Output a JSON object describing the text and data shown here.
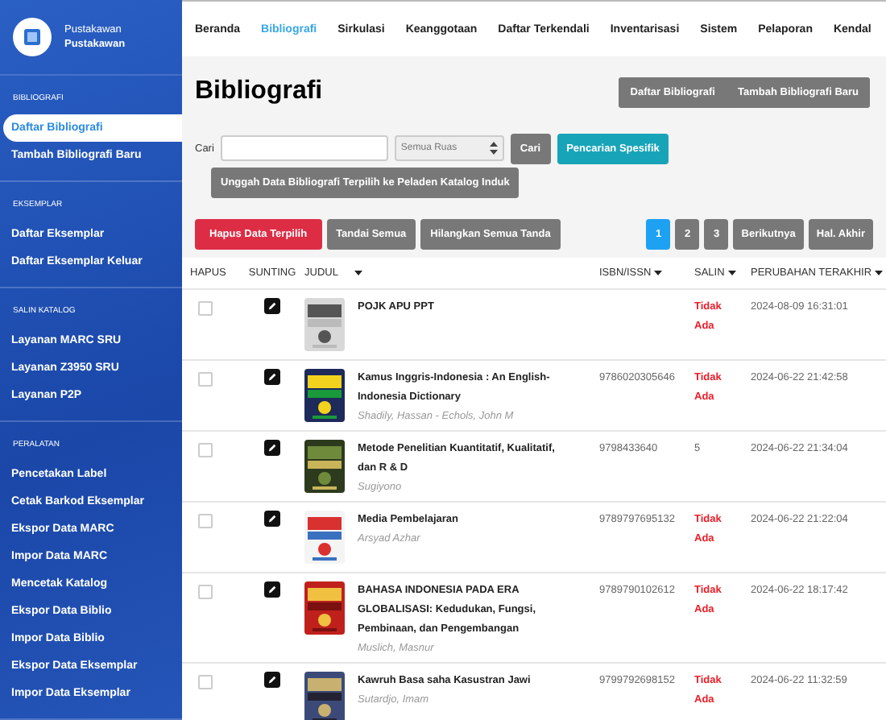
{
  "sidebar": {
    "user_role": "Pustakawan",
    "user_name": "Pustakawan",
    "sections": [
      {
        "label": "BIBLIOGRAFI",
        "items": [
          {
            "label": "Daftar Bibliografi",
            "selected": true
          },
          {
            "label": "Tambah Bibliografi Baru",
            "selected": false
          }
        ]
      },
      {
        "label": "EKSEMPLAR",
        "items": [
          {
            "label": "Daftar Eksemplar",
            "selected": false
          },
          {
            "label": "Daftar Eksemplar Keluar",
            "selected": false
          }
        ]
      },
      {
        "label": "SALIN KATALOG",
        "items": [
          {
            "label": "Layanan MARC SRU",
            "selected": false
          },
          {
            "label": "Layanan Z3950 SRU",
            "selected": false
          },
          {
            "label": "Layanan P2P",
            "selected": false
          }
        ]
      },
      {
        "label": "PERALATAN",
        "items": [
          {
            "label": "Pencetakan Label",
            "selected": false
          },
          {
            "label": "Cetak Barkod Eksemplar",
            "selected": false
          },
          {
            "label": "Ekspor Data MARC",
            "selected": false
          },
          {
            "label": "Impor Data MARC",
            "selected": false
          },
          {
            "label": "Mencetak Katalog",
            "selected": false
          },
          {
            "label": "Ekspor Data Biblio",
            "selected": false
          },
          {
            "label": "Impor Data Biblio",
            "selected": false
          },
          {
            "label": "Ekspor Data Eksemplar",
            "selected": false
          },
          {
            "label": "Impor Data Eksemplar",
            "selected": false
          }
        ]
      }
    ]
  },
  "nav": [
    {
      "label": "Beranda",
      "selected": false
    },
    {
      "label": "Bibliografi",
      "selected": true
    },
    {
      "label": "Sirkulasi",
      "selected": false
    },
    {
      "label": "Keanggotaan",
      "selected": false
    },
    {
      "label": "Daftar Terkendali",
      "selected": false
    },
    {
      "label": "Inventarisasi",
      "selected": false
    },
    {
      "label": "Sistem",
      "selected": false
    },
    {
      "label": "Pelaporan",
      "selected": false
    },
    {
      "label": "Kendal",
      "selected": false
    }
  ],
  "title": "Bibliografi",
  "header_buttons": [
    "Daftar Bibliografi",
    "Tambah Bibliografi Baru"
  ],
  "search": {
    "label": "Cari",
    "field_select": "Semua Ruas",
    "search_button": "Cari",
    "advanced_button": "Pencarian Spesifik",
    "upload_button": "Unggah Data Bibliografi Terpilih ke Peladen Katalog Induk"
  },
  "actions": [
    {
      "label": "Hapus Data Terpilih",
      "kind": "danger"
    },
    {
      "label": "Tandai Semua",
      "kind": "default"
    },
    {
      "label": "Hilangkan Semua Tanda",
      "kind": "default"
    }
  ],
  "pagination": [
    {
      "label": "1",
      "selected": true
    },
    {
      "label": "2",
      "selected": false
    },
    {
      "label": "3",
      "selected": false
    },
    {
      "label": "Berikutnya",
      "selected": false
    },
    {
      "label": "Hal. Akhir",
      "selected": false
    }
  ],
  "table": {
    "columns": [
      {
        "label": "HAPUS",
        "sortable": false
      },
      {
        "label": "SUNTING",
        "sortable": false
      },
      {
        "label": "JUDUL",
        "sortable": true
      },
      {
        "label": "ISBN/ISSN",
        "sortable": true
      },
      {
        "label": "SALIN",
        "sortable": true
      },
      {
        "label": "PERUBAHAN TERAKHIR",
        "sortable": true
      }
    ],
    "rows": [
      {
        "checked": false,
        "title": "POJK APU PPT",
        "isbn": "",
        "copies": "Tidak Ada",
        "missing": true,
        "modified": "2024-08-09 16:31:01"
      },
      {
        "checked": false,
        "title": "Kamus Inggris-Indonesia : An English-Indonesia Dictionary",
        "author": "Shadily, Hassan - Echols, John M",
        "isbn": "9786020305646",
        "copies": "Tidak Ada",
        "missing": true,
        "modified": "2024-06-22 21:42:58"
      },
      {
        "checked": false,
        "title": "Metode Penelitian Kuantitatif, Kualitatif, dan R & D",
        "author": "Sugiyono",
        "isbn": "9798433640",
        "copies": "5",
        "missing": false,
        "modified": "2024-06-22 21:34:04"
      },
      {
        "checked": false,
        "title": "Media Pembelajaran",
        "author": "Arsyad Azhar",
        "isbn": "9789797695132",
        "copies": "Tidak Ada",
        "missing": true,
        "modified": "2024-06-22 21:22:04"
      },
      {
        "checked": false,
        "title": "BAHASA INDONESIA PADA ERA GLOBALISASI: Kedudukan, Fungsi, Pembinaan, dan Pengembangan",
        "author": "Muslich, Masnur",
        "isbn": "9789790102612",
        "copies": "Tidak Ada",
        "missing": true,
        "modified": "2024-06-22 18:17:42"
      },
      {
        "checked": false,
        "title": "Kawruh Basa saha Kasustran Jawi",
        "author": "Sutardjo, Imam",
        "isbn": "9799792698152",
        "copies": "Tidak Ada",
        "missing": true,
        "modified": "2024-06-22 11:32:59"
      }
    ]
  }
}
